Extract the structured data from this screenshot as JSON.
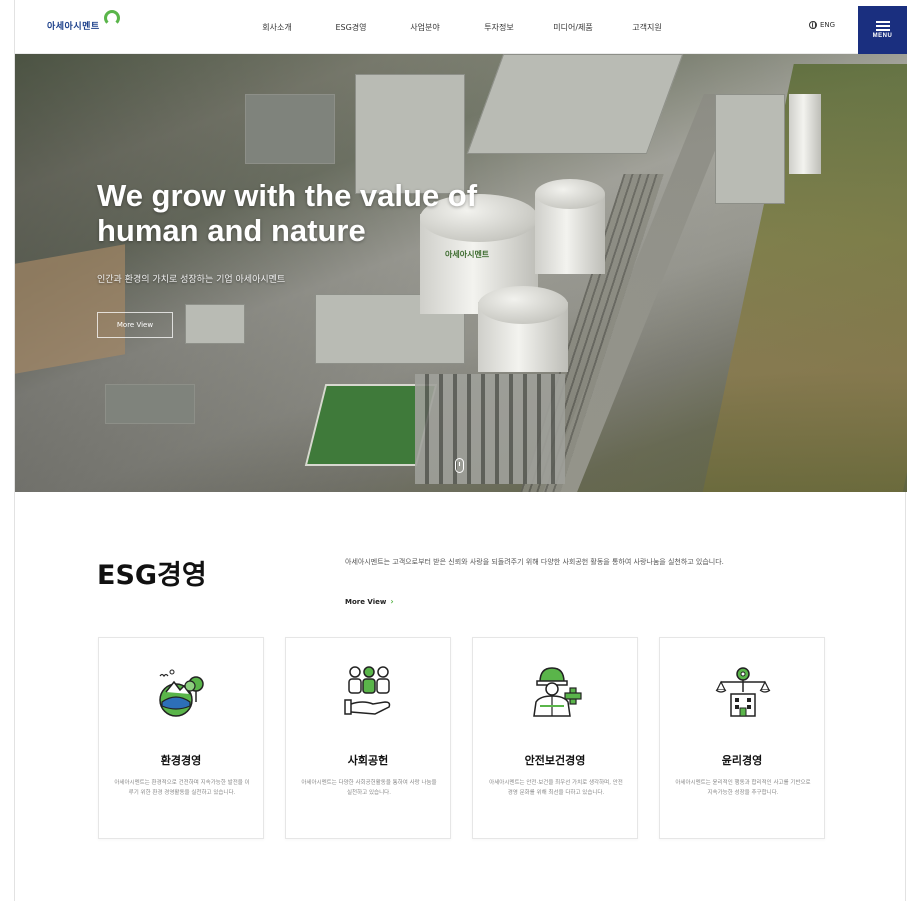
{
  "header": {
    "logo_text": "아세아시멘트",
    "nav": [
      "회사소개",
      "ESG경영",
      "사업분야",
      "투자정보",
      "미디어/제품",
      "고객지원"
    ],
    "lang_label": "ENG",
    "menu_label": "MENU"
  },
  "hero": {
    "title_line1": "We grow with the value of",
    "title_line2": "human and nature",
    "subtitle": "인간과 환경의 가치로 성장하는 기업 아세아시멘트",
    "more_label": "More View",
    "silo_label": "아세아시멘트"
  },
  "esg": {
    "title": "ESG경영",
    "desc": "아세아시멘트는 고객으로부터 받은 신뢰와 사랑을 되돌려주기 위해 다양한 사회공헌 활동을 통하여 사랑나눔을 실천하고 있습니다.",
    "more_label": "More View",
    "cards": [
      {
        "title": "환경경영",
        "desc": "아세아시멘트는 환경적으로 건전하며 지속가능한 발전을 이루기 위한 환경 경영활동을 실천하고 있습니다.",
        "icon": "environment-icon"
      },
      {
        "title": "사회공헌",
        "desc": "아세아시멘트는 다양한 사회공헌활동을 통하여 사랑 나눔을 실천하고 있습니다.",
        "icon": "social-contribution-icon"
      },
      {
        "title": "안전보건경영",
        "desc": "아세아시멘트는 안전·보건을 최우선 가치로 생각하며, 안전경영 문화를 위해 최선을 다하고 있습니다.",
        "icon": "safety-health-icon"
      },
      {
        "title": "윤리경영",
        "desc": "아세아시멘트는 윤리적인 행동과 합리적인 사고를 기반으로 지속가능한 성장을 추구합니다.",
        "icon": "ethics-icon"
      }
    ]
  },
  "colors": {
    "brand_navy": "#1a2f7f",
    "brand_green": "#5ab54a"
  }
}
